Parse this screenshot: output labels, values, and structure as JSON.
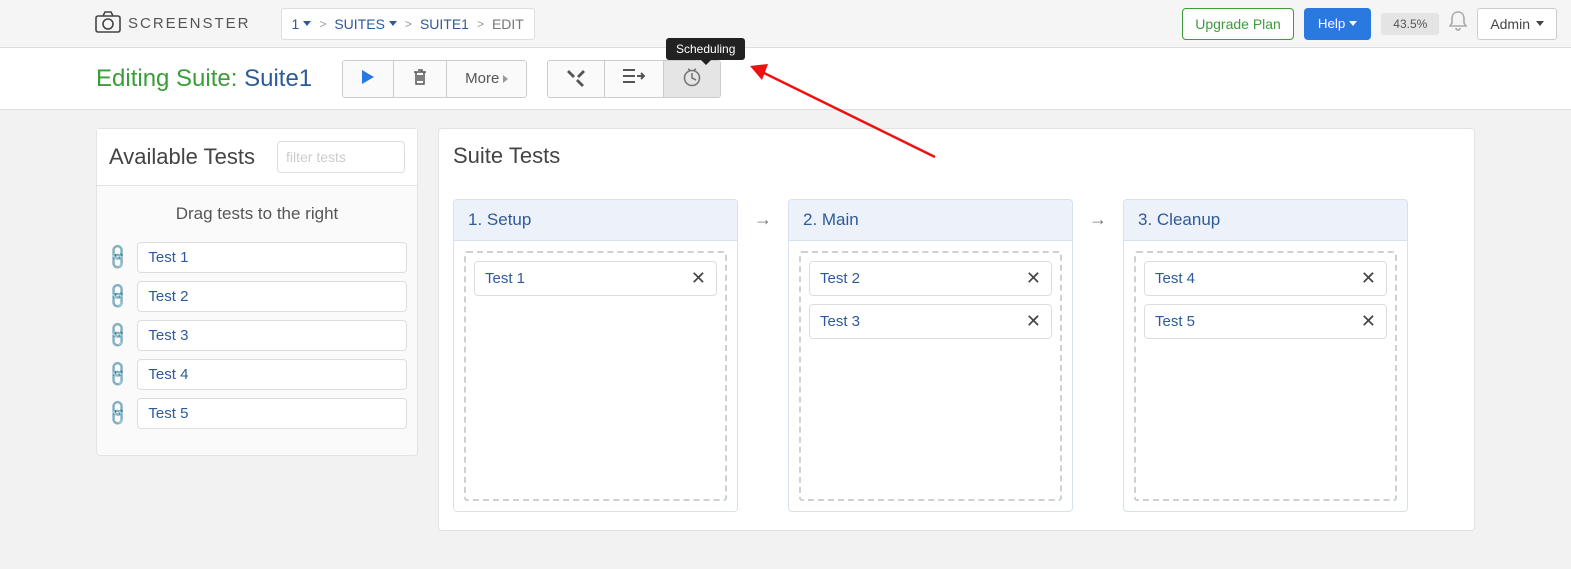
{
  "app": {
    "name": "SCREENSTER"
  },
  "breadcrumb": {
    "items": [
      {
        "label": "1",
        "dropdown": true,
        "static": false
      },
      {
        "label": "SUITES",
        "dropdown": true,
        "static": false
      },
      {
        "label": "SUITE1",
        "dropdown": false,
        "static": false
      },
      {
        "label": "EDIT",
        "dropdown": false,
        "static": true
      }
    ]
  },
  "topright": {
    "upgrade": "Upgrade Plan",
    "help": "Help",
    "percent": "43.5%",
    "admin": "Admin"
  },
  "subbar": {
    "title_prefix": "Editing Suite:",
    "suite_name": "Suite1",
    "more_label": "More"
  },
  "tooltip": "Scheduling",
  "available": {
    "title": "Available Tests",
    "filter_placeholder": "filter tests",
    "drag_hint": "Drag tests to the right",
    "items": [
      {
        "label": "Test 1"
      },
      {
        "label": "Test 2"
      },
      {
        "label": "Test 3"
      },
      {
        "label": "Test 4"
      },
      {
        "label": "Test 5"
      }
    ]
  },
  "suite_tests": {
    "title": "Suite Tests",
    "columns": [
      {
        "label": "1.  Setup",
        "tests": [
          "Test 1"
        ]
      },
      {
        "label": "2.  Main",
        "tests": [
          "Test 2",
          "Test 3"
        ]
      },
      {
        "label": "3.  Cleanup",
        "tests": [
          "Test 4",
          "Test 5"
        ]
      }
    ]
  }
}
